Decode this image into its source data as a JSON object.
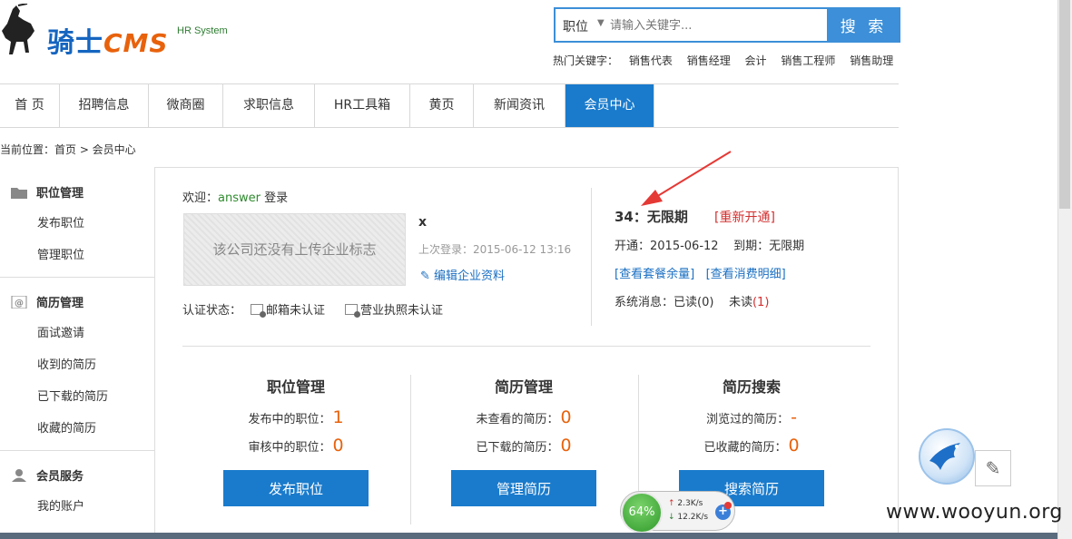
{
  "header": {
    "logo_text": "骑士",
    "logo_cms": "CMS",
    "logo_sub": "HR System",
    "search": {
      "type_label": "职位",
      "placeholder": "请输入关键字...",
      "button_label": "搜 索"
    },
    "hot_keywords_label": "热门关键字：",
    "hot_keywords": [
      "销售代表",
      "销售经理",
      "会计",
      "销售工程师",
      "销售助理"
    ]
  },
  "nav": {
    "items": [
      {
        "label": "首 页",
        "width": 66
      },
      {
        "label": "招聘信息",
        "width": 98
      },
      {
        "label": "微商圈",
        "width": 82
      },
      {
        "label": "求职信息",
        "width": 101
      },
      {
        "label": "HR工具箱",
        "width": 105
      },
      {
        "label": "黄页",
        "width": 70
      },
      {
        "label": "新闻资讯",
        "width": 101
      },
      {
        "label": "会员中心",
        "width": 98,
        "active": true
      }
    ]
  },
  "breadcrumb": "当前位置：首页 > 会员中心",
  "sidebar": {
    "groups": [
      {
        "title": "职位管理",
        "items": [
          "发布职位",
          "管理职位"
        ]
      },
      {
        "title": "简历管理",
        "items": [
          "面试邀请",
          "收到的简历",
          "已下载的简历",
          "收藏的简历"
        ]
      },
      {
        "title": "会员服务",
        "items": [
          "我的账户"
        ]
      }
    ]
  },
  "profile": {
    "welcome_prefix": "欢迎：",
    "username": "answer",
    "welcome_suffix": " 登录",
    "logo_placeholder": "该公司还没有上传企业标志",
    "company_name": "x",
    "last_login": "上次登录：2015-06-12 13:16",
    "edit_link": "编辑企业资料",
    "auth_label": "认证状态：",
    "auth_email": "邮箱未认证",
    "auth_license": "营业执照未认证"
  },
  "plan": {
    "title": "34：无限期",
    "reopen": "[重新开通]",
    "start": "开通：2015-06-12",
    "end": "到期：无限期",
    "link_balance": "[查看套餐余量]",
    "link_consumption": "[查看消费明细]",
    "sys_label": "系统消息：",
    "read": "已读(0)",
    "unread_label": "未读",
    "unread_count": "(1)"
  },
  "stats": [
    {
      "title": "职位管理",
      "rows": [
        {
          "label": "发布中的职位：",
          "value": "1"
        },
        {
          "label": "审核中的职位：",
          "value": "0"
        }
      ],
      "button": "发布职位"
    },
    {
      "title": "简历管理",
      "rows": [
        {
          "label": "未查看的简历：",
          "value": "0"
        },
        {
          "label": "已下载的简历：",
          "value": "0"
        }
      ],
      "button": "管理简历"
    },
    {
      "title": "简历搜索",
      "rows": [
        {
          "label": "浏览过的简历：",
          "value": "-"
        },
        {
          "label": "已收藏的简历：",
          "value": "0"
        }
      ],
      "button": "搜索简历"
    }
  ],
  "speed_widget": {
    "percent": "64%",
    "up": "2.3K/s",
    "down": "12.2K/s"
  },
  "watermark": "www.wooyun.org",
  "colors": {
    "accent": "#1a7bcc",
    "number": "#e8620c",
    "alert": "#d32f2f"
  }
}
